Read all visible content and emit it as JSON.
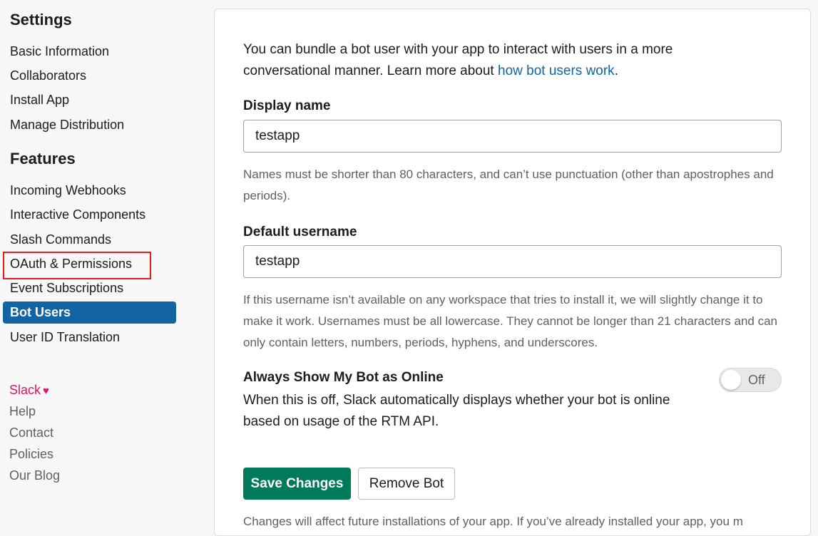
{
  "sidebar": {
    "settings_title": "Settings",
    "settings_items": [
      {
        "label": "Basic Information"
      },
      {
        "label": "Collaborators"
      },
      {
        "label": "Install App"
      },
      {
        "label": "Manage Distribution"
      }
    ],
    "features_title": "Features",
    "features_items": [
      {
        "label": "Incoming Webhooks"
      },
      {
        "label": "Interactive Components"
      },
      {
        "label": "Slash Commands"
      },
      {
        "label": "OAuth & Permissions"
      },
      {
        "label": "Event Subscriptions"
      },
      {
        "label": "Bot Users",
        "active": true
      },
      {
        "label": "User ID Translation"
      }
    ],
    "footer": {
      "slack": "Slack",
      "heart": "♥",
      "help": "Help",
      "contact": "Contact",
      "policies": "Policies",
      "blog": "Our Blog"
    }
  },
  "main": {
    "intro_text": "You can bundle a bot user with your app to interact with users in a more conversational manner. Learn more about ",
    "intro_link": "how bot users work",
    "intro_end": ".",
    "display_name": {
      "label": "Display name",
      "value": "testapp",
      "hint": "Names must be shorter than 80 characters, and can’t use punctuation (other than apostrophes and periods)."
    },
    "default_username": {
      "label": "Default username",
      "value": "testapp",
      "hint": "If this username isn’t available on any workspace that tries to install it, we will slightly change it to make it work. Usernames must be all lowercase. They cannot be longer than 21 characters and can only contain letters, numbers, periods, hyphens, and underscores."
    },
    "online_toggle": {
      "title": "Always Show My Bot as Online",
      "description": "When this is off, Slack automatically displays whether your bot is online based on usage of the RTM API.",
      "state": "Off"
    },
    "save_button": "Save Changes",
    "remove_button": "Remove Bot",
    "cutoff_text": "Changes will affect future installations of your app. If you’ve already installed your app, you m"
  },
  "colors": {
    "active_nav": "#1264a3",
    "primary_button": "#007a5a",
    "link": "#1264a3",
    "highlight_box": "#e01e1e",
    "slack_pink": "#e01563"
  }
}
